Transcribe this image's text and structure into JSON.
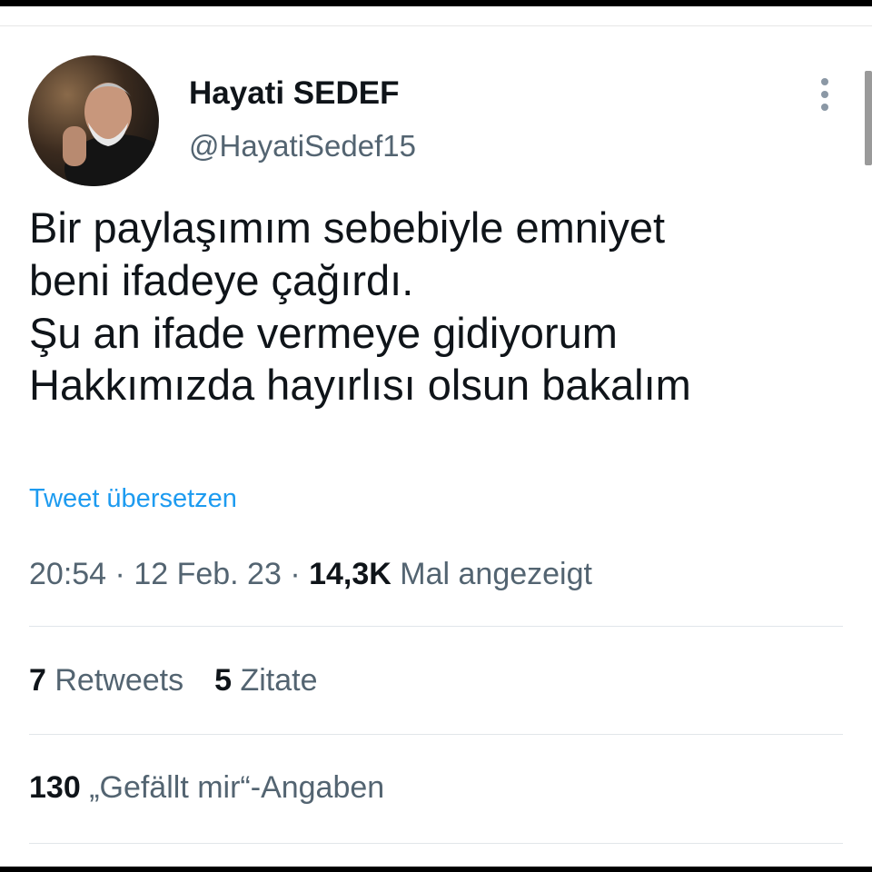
{
  "author": {
    "display_name": "Hayati SEDEF",
    "username": "@HayatiSedef15"
  },
  "tweet": {
    "lines": [
      "Bir paylaşımım sebebiyle emniyet",
      "beni ifadeye çağırdı.",
      "Şu an ifade vermeye gidiyorum",
      "Hakkımızda hayırlısı olsun bakalım"
    ],
    "translate_label": "Tweet übersetzen"
  },
  "meta": {
    "time": "20:54",
    "separator": " · ",
    "date": "12 Feb. 23",
    "views_count": "14,3K",
    "views_label": "Mal angezeigt"
  },
  "stats": {
    "retweets_count": "7",
    "retweets_label": "Retweets",
    "quotes_count": "5",
    "quotes_label": "Zitate",
    "likes_count": "130",
    "likes_label": "„Gefällt mir“-Angaben"
  },
  "icons": {
    "more": "more-vertical-icon"
  },
  "colors": {
    "link": "#1d9bf0",
    "secondary_text": "#536471",
    "primary_text": "#0f1419"
  }
}
